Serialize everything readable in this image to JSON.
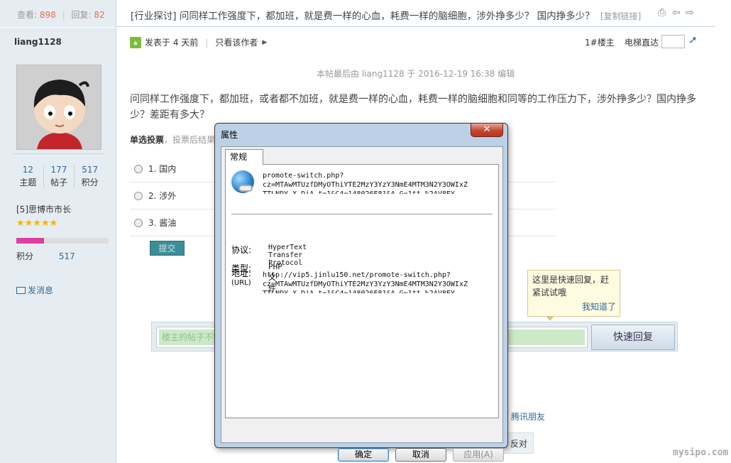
{
  "topbar": {
    "views_label": "查看:",
    "views": "898",
    "replies_label": "回复:",
    "replies": "82",
    "title": "[行业探讨] 问同样工作强度下，都加班，就是费一样的心血，耗费一样的脑细胞，涉外挣多少？ 国内挣多少？",
    "copy_link": "[复制链接]"
  },
  "author": {
    "name": "liang1128",
    "stats": [
      {
        "value": "12",
        "label": "主题"
      },
      {
        "value": "177",
        "label": "帖子"
      },
      {
        "value": "517",
        "label": "积分"
      }
    ],
    "rank": "[5]思博市市长",
    "stars": "★★★★★",
    "progress_fraction": 0.3,
    "points_label": "积分",
    "points_value": "517",
    "pm_label": "发消息"
  },
  "post": {
    "posted_label": "发表于",
    "posted_time": "4 天前",
    "only_author": "只看该作者",
    "floor": "1#楼主",
    "elevator": "电梯直达",
    "edit_note": "本帖最后由 liang1128 于 2016-12-19 16:38 编辑",
    "body": "问同样工作强度下，都加班，或者都不加班，就是费一样的心血，耗费一样的脑细胞和同等的工作压力下，涉外挣多少？国内挣多少？差距有多大？",
    "poll_title": "单选投票",
    "poll_hint": "，投票后结果",
    "options": [
      {
        "label": "1.  国内"
      },
      {
        "label": "2.  涉外"
      },
      {
        "label": "3.  酱油"
      }
    ],
    "submit_label": "提交"
  },
  "reply": {
    "placeholder": "楼主的帖子不错",
    "quick_reply_label": "快速回复"
  },
  "tooltip": {
    "text": "这里是快速回复，赶紧试试哦",
    "ok": "我知道了"
  },
  "bottom": {
    "qq": "腾讯朋友",
    "oppose": "反对",
    "watermark": "mysipo.com"
  },
  "dialog": {
    "title": "属性",
    "close": "✕",
    "tab": "常规",
    "name": "promote-switch.php?\ncz=MTAwMTUzfDMyOThiYTE2MzY3YzY3NmE4MTM3N2Y3OWIxZ\nTTLNDY_X_DiA_t=1&C4=148026E81&A_G=1tt_%2AV8EY",
    "protocol_label": "协议:",
    "protocol": "HyperText Transfer Protocol",
    "type_label": "类型:",
    "type": "PHP 文件",
    "address_label": "地址:",
    "address_sub": "(URL)",
    "address": "http://vip5.jinlu150.net/promote-switch.php?\ncz=MTAwMTUzfDMyOThiYTE2MzY3YzY3NmE4MTM3N2Y3OWIxZ\nTTLNDY_X_DiA_t=1&C4=148026E81&A_G=1tt_%2AV8EY",
    "ok": "确定",
    "cancel": "取消",
    "apply": "应用(A)"
  }
}
